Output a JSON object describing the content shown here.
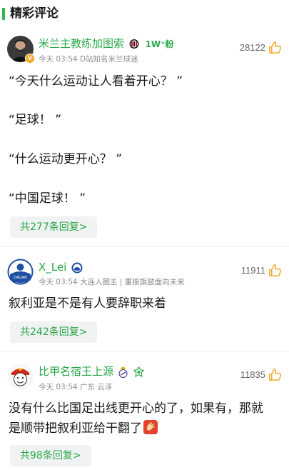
{
  "section": {
    "title": "精彩评论"
  },
  "comments": [
    {
      "username": "米兰主教练加图索",
      "badge_text": "1W⁺粉",
      "time": "今天 03:54",
      "meta_extra": "D站知名米兰球迷",
      "likes": "28122",
      "lines": [
        "“今天什么运动让人看着开心？ ”",
        "“足球！ ”",
        "“什么运动更开心？ ”",
        "“中国足球！ ”"
      ],
      "replies": "共277条回复>"
    },
    {
      "username": "X_Lei",
      "time": "今天 03:54",
      "meta_extra": "大连人圈主 | 重振旗鼓面向未来",
      "likes": "11911",
      "lines": [
        "叙利亚是不是有人要辞职来着"
      ],
      "replies": "共242条回复>"
    },
    {
      "username": "比甲名宿王上源",
      "time": "今天 03:54",
      "meta_extra": "广东 云浮",
      "likes": "11835",
      "lines": [
        "没有什么比国足出线更开心的了，如果有，那就",
        "是顺带把叙利亚给干翻了"
      ],
      "replies": "共98条回复>"
    }
  ],
  "colors": {
    "accent": "#2aa84a",
    "meta": "#8a8a8a",
    "like_icon": "#f5a623"
  },
  "icons": [
    "verified-icon",
    "ac-milan-badge-icon",
    "dalian-club-icon",
    "real-madrid-badge-icon",
    "green-club-icon",
    "thumbs-up-icon",
    "clapping-hands-emoji"
  ]
}
